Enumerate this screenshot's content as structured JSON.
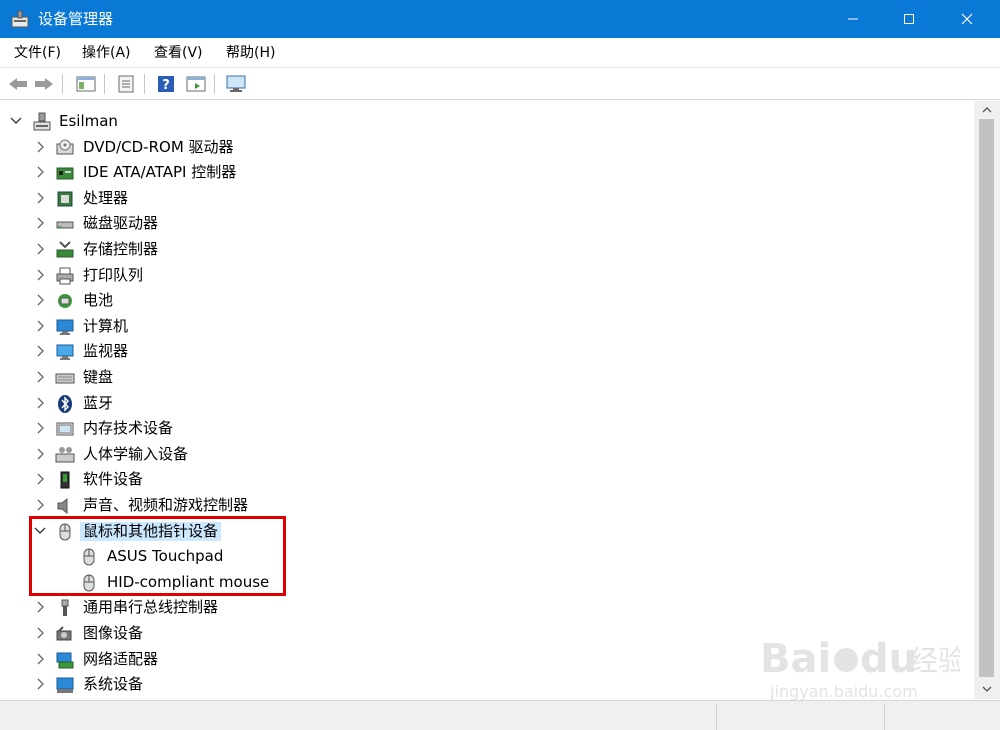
{
  "window": {
    "title": "设备管理器",
    "app_icon": "device-manager-icon",
    "controls": [
      "minimize-icon",
      "maximize-icon",
      "close-icon"
    ]
  },
  "menu": [
    "文件(F)",
    "操作(A)",
    "查看(V)",
    "帮助(H)"
  ],
  "toolbar": [
    "back-arrow-icon",
    "forward-arrow-icon",
    "show-hide-console-tree-icon",
    "properties-icon",
    "help-icon",
    "action-pane-icon",
    "scan-hardware-icon"
  ],
  "tree": {
    "root": "Esilman",
    "items": [
      {
        "label": "DVD/CD-ROM 驱动器",
        "icon": "dvd-drive-icon"
      },
      {
        "label": "IDE ATA/ATAPI 控制器",
        "icon": "ide-controller-icon"
      },
      {
        "label": "处理器",
        "icon": "processor-icon"
      },
      {
        "label": "磁盘驱动器",
        "icon": "disk-drive-icon"
      },
      {
        "label": "存储控制器",
        "icon": "storage-controller-icon"
      },
      {
        "label": "打印队列",
        "icon": "printer-icon"
      },
      {
        "label": "电池",
        "icon": "battery-icon"
      },
      {
        "label": "计算机",
        "icon": "computer-icon"
      },
      {
        "label": "监视器",
        "icon": "monitor-icon"
      },
      {
        "label": "键盘",
        "icon": "keyboard-icon"
      },
      {
        "label": "蓝牙",
        "icon": "bluetooth-icon"
      },
      {
        "label": "内存技术设备",
        "icon": "memory-device-icon"
      },
      {
        "label": "人体学输入设备",
        "icon": "hid-icon"
      },
      {
        "label": "软件设备",
        "icon": "software-device-icon"
      },
      {
        "label": "声音、视频和游戏控制器",
        "icon": "speaker-icon"
      },
      {
        "label": "鼠标和其他指针设备",
        "icon": "mouse-icon",
        "expanded": true,
        "selected": true,
        "children": [
          "ASUS Touchpad",
          "HID-compliant mouse"
        ]
      },
      {
        "label": "通用串行总线控制器",
        "icon": "usb-icon"
      },
      {
        "label": "图像设备",
        "icon": "camera-icon"
      },
      {
        "label": "网络适配器",
        "icon": "network-adapter-icon"
      },
      {
        "label": "系统设备",
        "icon": "system-device-icon"
      }
    ]
  },
  "colors": {
    "titlebar": "#0a79d6",
    "selection": "#cce8ff",
    "highlight_box": "#e00000"
  },
  "watermark": {
    "brand": "Baidu",
    "brand_cn": "经验",
    "url": "jingyan.baidu.com"
  }
}
